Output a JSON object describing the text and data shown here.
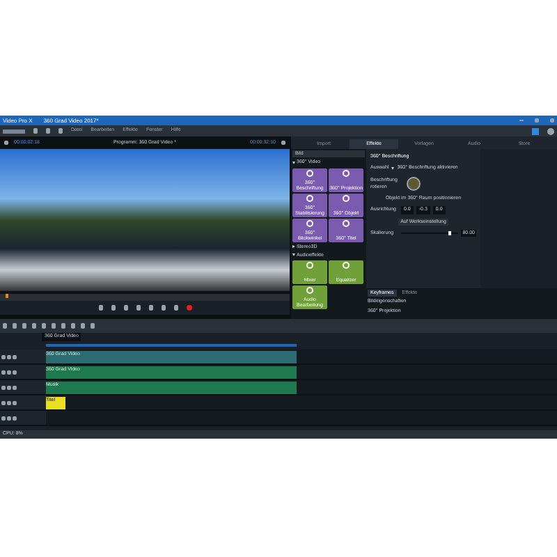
{
  "window": {
    "app": "Video Pro X",
    "title": "360 Grad Video 2017*"
  },
  "menu": [
    "Datei",
    "Bearbeiten",
    "Effekte",
    "Fenster",
    "Hilfe"
  ],
  "preview": {
    "time_left": "00:00:02:18",
    "title": "Programm: 360 Grad Video *",
    "time_right": "00:00:32:10"
  },
  "tabs": [
    {
      "label": "Import",
      "selected": false
    },
    {
      "label": "Effekte",
      "selected": true
    },
    {
      "label": "Vorlagen",
      "selected": false
    },
    {
      "label": "Audio",
      "selected": false
    },
    {
      "label": "Store",
      "selected": false
    }
  ],
  "effects": {
    "back": "Bild",
    "groups": [
      {
        "title": "360° Video",
        "expanded": true,
        "color": "#7b5bb0",
        "tiles": [
          "360° Beschriftung",
          "360° Projektion",
          "360° Stabilisierung",
          "360° Objekt",
          "360° Blickwinkel",
          "360° Titel"
        ]
      },
      {
        "title": "Stereo3D",
        "expanded": false
      },
      {
        "title": "Audioeffekte",
        "expanded": true,
        "color": "#6fa03a",
        "tiles": [
          "Mixer",
          "Equalizer",
          "Audio Bearbeitung"
        ]
      }
    ]
  },
  "settings": {
    "title": "360° Beschriftung",
    "preset_label": "Auswahl",
    "preset": "360° Beschriftung aktivieren",
    "label_left": "Beschriftung rotieren",
    "hint": "Objekt im 360° Raum positionieren",
    "axis_label": "Ausrichtung",
    "values": [
      "0.0",
      "-0.3",
      "0.0"
    ],
    "reset": "Auf Werkseinstellung",
    "slider_label": "Skalierung",
    "level": 0.82,
    "slider_value": "80.00"
  },
  "keyframes": {
    "tabs": [
      {
        "label": "Keyframes",
        "selected": true
      },
      {
        "label": "Effekte",
        "selected": false
      }
    ],
    "rows": [
      "Bildeigenschaften",
      "360° Projektion"
    ]
  },
  "timeline": {
    "project": "360 Grad Video",
    "tracks": [
      {
        "kind": "video",
        "clip": "360 Grad Video"
      },
      {
        "kind": "audio",
        "clip": "360 Grad Video"
      },
      {
        "kind": "audio",
        "clip": "Musik"
      },
      {
        "kind": "title",
        "clip": "Titel"
      },
      {
        "kind": "empty"
      }
    ]
  },
  "status": "CPU: 8%"
}
